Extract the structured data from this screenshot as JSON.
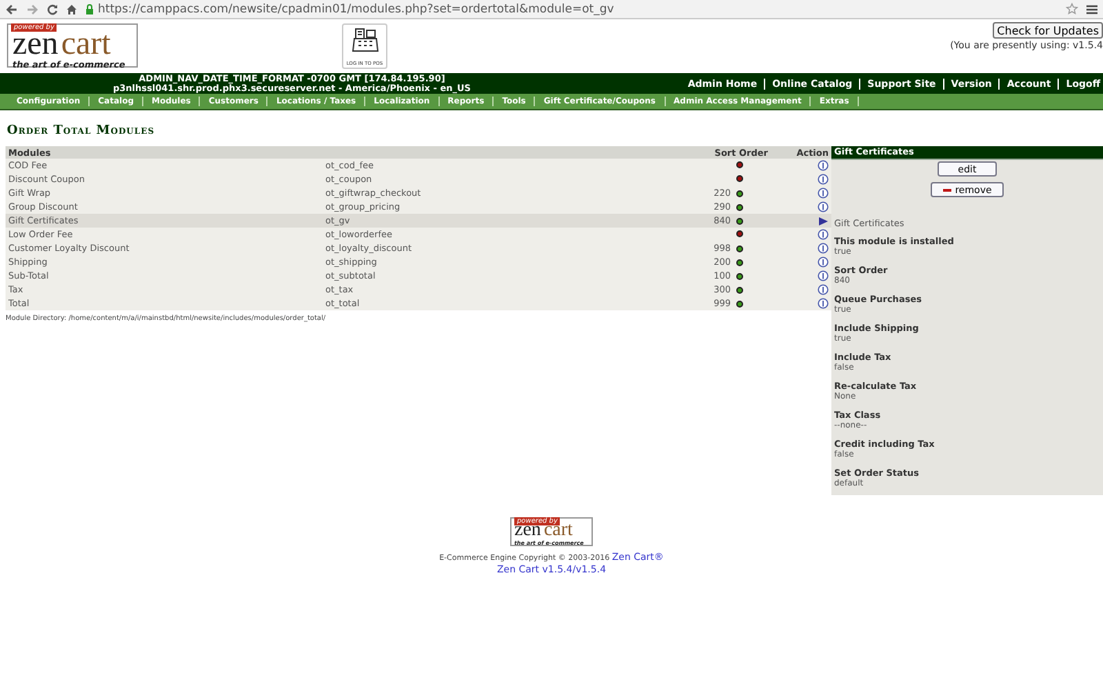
{
  "browser": {
    "url": "https://camppacs.com/newsite/cpadmin01/modules.php?set=ordertotal&module=ot_gv"
  },
  "header": {
    "logo": {
      "tag": "powered by",
      "word1": "zen",
      "word2": "cart",
      "tagline": "the art of e-commerce"
    },
    "pos_label": "LOG IN TO POS",
    "update_button": "Check for Updates",
    "version_note": "(You are presently using: v1.5.4"
  },
  "info_bar": {
    "line1": "ADMIN_NAV_DATE_TIME_FORMAT -0700 GMT [174.84.195.90]",
    "line2": "p3nlhssl041.shr.prod.phx3.secureserver.net - America/Phoenix - en_US",
    "links": [
      "Admin Home",
      "Online Catalog",
      "Support Site",
      "Version",
      "Account",
      "Logoff"
    ]
  },
  "menu": [
    "Configuration",
    "Catalog",
    "Modules",
    "Customers",
    "Locations / Taxes",
    "Localization",
    "Reports",
    "Tools",
    "Gift Certificate/Coupons",
    "Admin Access Management",
    "Extras"
  ],
  "page_title": "Order Total Modules",
  "table": {
    "columns": [
      "Modules",
      "Sort Order",
      "Action"
    ],
    "rows": [
      {
        "name": "COD Fee",
        "code": "ot_cod_fee",
        "sort": "",
        "installed": false,
        "selected": false
      },
      {
        "name": "Discount Coupon",
        "code": "ot_coupon",
        "sort": "",
        "installed": false,
        "selected": false
      },
      {
        "name": "Gift Wrap",
        "code": "ot_giftwrap_checkout",
        "sort": "220",
        "installed": true,
        "selected": false
      },
      {
        "name": "Group Discount",
        "code": "ot_group_pricing",
        "sort": "290",
        "installed": true,
        "selected": false
      },
      {
        "name": "Gift Certificates",
        "code": "ot_gv",
        "sort": "840",
        "installed": true,
        "selected": true
      },
      {
        "name": "Low Order Fee",
        "code": "ot_loworderfee",
        "sort": "",
        "installed": false,
        "selected": false
      },
      {
        "name": "Customer Loyalty Discount",
        "code": "ot_loyalty_discount",
        "sort": "998",
        "installed": true,
        "selected": false
      },
      {
        "name": "Shipping",
        "code": "ot_shipping",
        "sort": "200",
        "installed": true,
        "selected": false
      },
      {
        "name": "Sub-Total",
        "code": "ot_subtotal",
        "sort": "100",
        "installed": true,
        "selected": false
      },
      {
        "name": "Tax",
        "code": "ot_tax",
        "sort": "300",
        "installed": true,
        "selected": false
      },
      {
        "name": "Total",
        "code": "ot_total",
        "sort": "999",
        "installed": true,
        "selected": false
      }
    ],
    "module_directory": "Module Directory: /home/content/m/a/i/mainstbd/html/newsite/includes/modules/order_total/"
  },
  "panel": {
    "title": "Gift Certificates",
    "buttons": [
      "edit",
      "remove"
    ],
    "description": "Gift Certificates",
    "settings": [
      {
        "label": "This module is installed",
        "value": "true"
      },
      {
        "label": "Sort Order",
        "value": "840"
      },
      {
        "label": "Queue Purchases",
        "value": "true"
      },
      {
        "label": "Include Shipping",
        "value": "true"
      },
      {
        "label": "Include Tax",
        "value": "false"
      },
      {
        "label": "Re-calculate Tax",
        "value": "None"
      },
      {
        "label": "Tax Class",
        "value": "--none--"
      },
      {
        "label": "Credit including Tax",
        "value": "false"
      },
      {
        "label": "Set Order Status",
        "value": "default"
      }
    ]
  },
  "footer": {
    "logo": {
      "tag": "powered by",
      "word1": "zen",
      "word2": "cart",
      "tagline": "the art of e-commerce"
    },
    "copyright": "E-Commerce Engine Copyright © 2003-2016",
    "link": "Zen Cart®",
    "version": "Zen Cart v1.5.4/v1.5.4"
  }
}
